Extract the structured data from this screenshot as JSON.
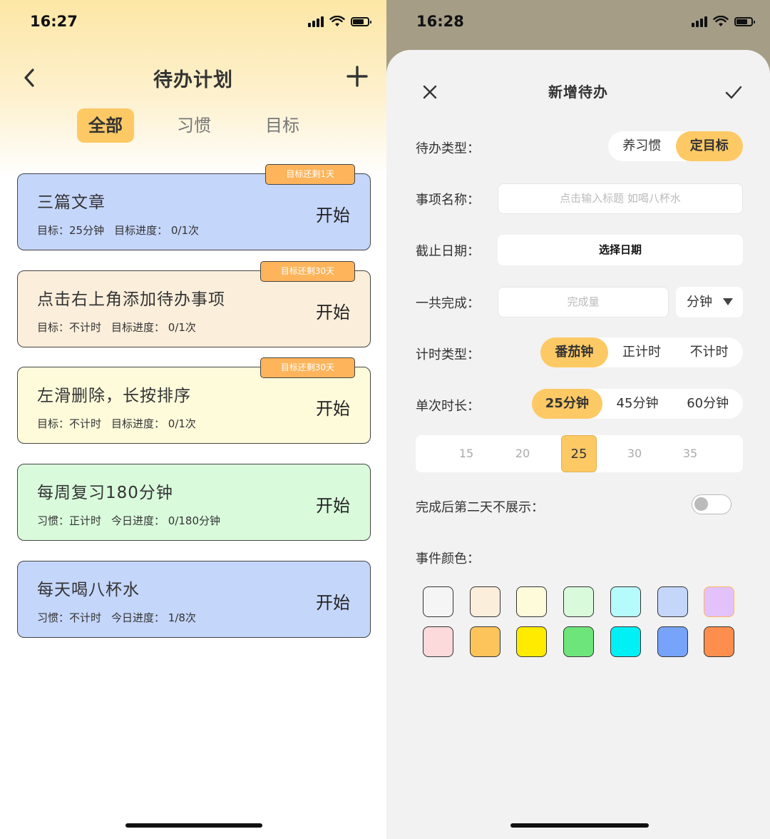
{
  "left": {
    "status": {
      "time": "16:27"
    },
    "nav": {
      "title": "待办计划",
      "back_icon": "chevron-left-icon",
      "add_icon": "plus-icon"
    },
    "tabs": [
      {
        "label": "全部",
        "active": true
      },
      {
        "label": "习惯",
        "active": false
      },
      {
        "label": "目标",
        "active": false
      }
    ],
    "cards": [
      {
        "title": "三篇文章",
        "meta1": "目标：25分钟",
        "meta2": "目标进度：  0/1次",
        "start": "开始",
        "badge": "目标还剩1天",
        "color": "#c5d6fb"
      },
      {
        "title": "点击右上角添加待办事项",
        "meta1": "目标：不计时",
        "meta2": "目标进度：  0/1次",
        "start": "开始",
        "badge": "目标还剩30天",
        "color": "#fbeedb"
      },
      {
        "title": "左滑删除，长按排序",
        "meta1": "目标：不计时",
        "meta2": "目标进度：  0/1次",
        "start": "开始",
        "badge": "目标还剩30天",
        "color": "#fefbdb"
      },
      {
        "title": "每周复习180分钟",
        "meta1": "习惯：正计时",
        "meta2": "今日进度：  0/180分钟",
        "start": "开始",
        "badge": "",
        "color": "#d9fbdc"
      },
      {
        "title": "每天喝八杯水",
        "meta1": "习惯：不计时",
        "meta2": "今日进度：  1/8次",
        "start": "开始",
        "badge": "",
        "color": "#c5d6fb"
      }
    ]
  },
  "right": {
    "status": {
      "time": "16:28"
    },
    "sheet": {
      "title": "新增待办",
      "close_icon": "close-icon",
      "confirm_icon": "checkmark-icon",
      "type_label": "待办类型：",
      "type_options": [
        {
          "label": "养习惯",
          "active": false
        },
        {
          "label": "定目标",
          "active": true
        }
      ],
      "name_label": "事项名称：",
      "name_placeholder": "点击输入标题 如喝八杯水",
      "deadline_label": "截止日期：",
      "deadline_button": "选择日期",
      "total_label": "一共完成：",
      "total_placeholder": "完成量",
      "unit_value": "分钟",
      "timer_label": "计时类型：",
      "timer_options": [
        {
          "label": "番茄钟",
          "active": true
        },
        {
          "label": "正计时",
          "active": false
        },
        {
          "label": "不计时",
          "active": false
        }
      ],
      "duration_label": "单次时长：",
      "duration_options": [
        {
          "label": "25分钟",
          "active": true
        },
        {
          "label": "45分钟",
          "active": false
        },
        {
          "label": "60分钟",
          "active": false
        }
      ],
      "picker_values": [
        "15",
        "20",
        "25",
        "30",
        "35"
      ],
      "picker_selected": "25",
      "hide_label": "完成后第二天不展示：",
      "hide_toggle_on": false,
      "color_label": "事件颜色：",
      "colors": [
        "#f5f5f5",
        "#fbeedb",
        "#fefbdb",
        "#d9fbdc",
        "#b6fbfb",
        "#c5d6fb",
        "#e3c2fb",
        "#fcd9da",
        "#fdc45b",
        "#ffeb00",
        "#6ee57a",
        "#00f0f5",
        "#77a3fa",
        "#fd8e4e"
      ],
      "selected_color": "#e3c2fb"
    }
  }
}
